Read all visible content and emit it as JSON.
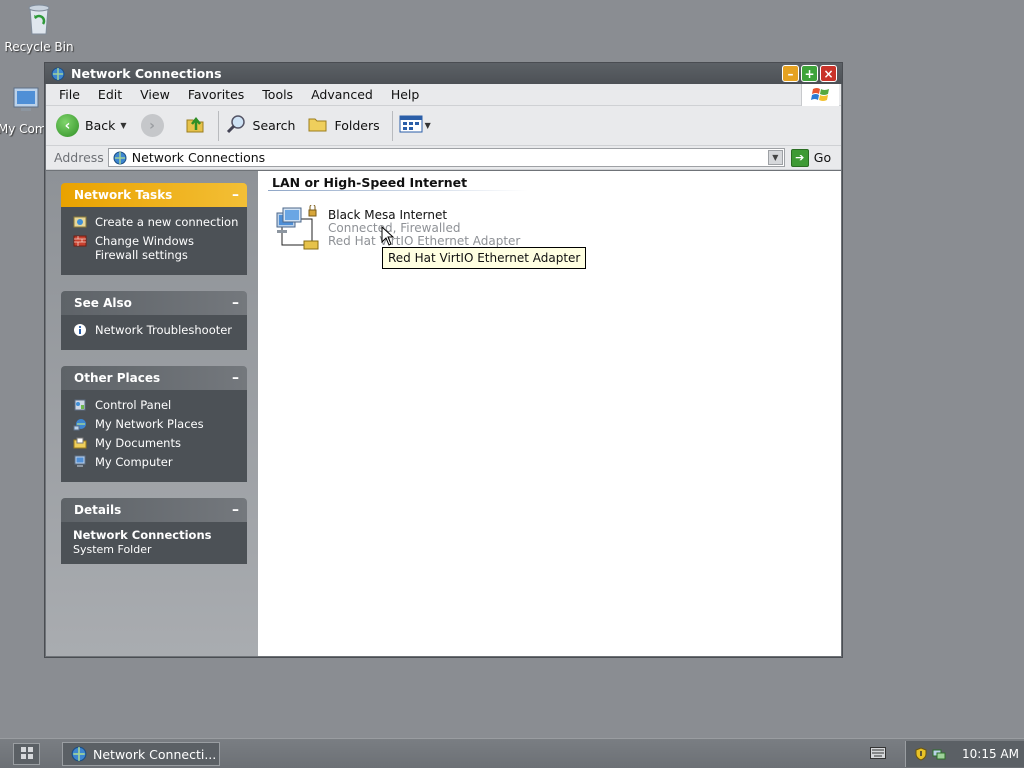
{
  "desktop": {
    "recycle_bin_label": "Recycle Bin",
    "my_computer_label": "My Comp"
  },
  "window": {
    "title": "Network Connections",
    "menu": [
      "File",
      "Edit",
      "View",
      "Favorites",
      "Tools",
      "Advanced",
      "Help"
    ],
    "toolbar": {
      "back_label": "Back",
      "search_label": "Search",
      "folders_label": "Folders"
    },
    "address": {
      "label": "Address",
      "value": "Network Connections",
      "go_label": "Go"
    }
  },
  "sidebar": {
    "network_tasks": {
      "title": "Network Tasks",
      "items": [
        "Create a new connection",
        "Change Windows Firewall settings"
      ]
    },
    "see_also": {
      "title": "See Also",
      "items": [
        "Network Troubleshooter"
      ]
    },
    "other_places": {
      "title": "Other Places",
      "items": [
        "Control Panel",
        "My Network Places",
        "My Documents",
        "My Computer"
      ]
    },
    "details": {
      "title": "Details",
      "name": "Network Connections",
      "type": "System Folder"
    }
  },
  "content": {
    "group_title": "LAN or High-Speed Internet",
    "connection": {
      "name": "Black Mesa Internet",
      "status": "Connected, Firewalled",
      "adapter": "Red Hat VirtIO Ethernet Adapter"
    },
    "tooltip": "Red Hat VirtIO Ethernet Adapter"
  },
  "taskbar": {
    "task_label": "Network Connecti...",
    "clock": "10:15 AM"
  },
  "colors": {
    "task_panel_header": "#e9a200",
    "panel_body": "#4c5156",
    "desktop": "#8a8d92"
  }
}
